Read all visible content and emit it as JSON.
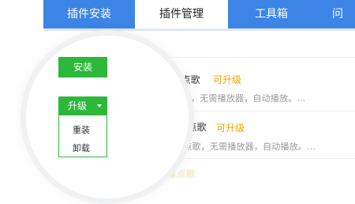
{
  "tabs": [
    {
      "label": "插件安装"
    },
    {
      "label": "插件管理",
      "active": true
    },
    {
      "label": "工具箱"
    },
    {
      "label": "问"
    }
  ],
  "plugins": [
    {
      "name_fragment": "bili弹幕点歌",
      "status": "可升级",
      "desc_fragment": "发弹幕点歌，无需播放器，自动播放。..."
    },
    {
      "name_fragment": "鱼TV弹幕点歌",
      "status": "可升级",
      "desc_fragment": "TV发弹幕点歌，无需播放器，自动播放。..."
    }
  ],
  "faded_text": "斗鱼TV弹幕点歌",
  "buttons": {
    "install": "安装",
    "upgrade": "升级"
  },
  "dropdown": {
    "items": [
      "重装",
      "卸载"
    ]
  },
  "colors": {
    "tab_bar": "#3c84e6",
    "green": "#2db83b",
    "upgradable": "#f0a300"
  }
}
